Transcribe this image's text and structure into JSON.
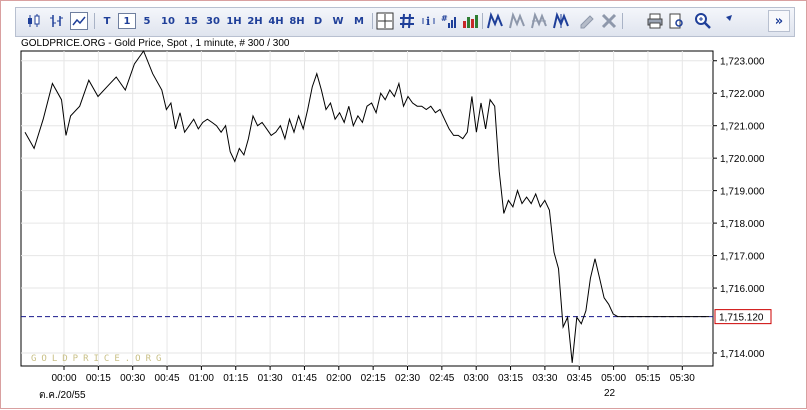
{
  "toolbar": {
    "icons": [
      "candlestick-icon",
      "bar-chart-icon",
      "line-chart-icon"
    ],
    "timeframes": [
      "T",
      "1",
      "5",
      "10",
      "15",
      "30",
      "1H",
      "2H",
      "4H",
      "8H",
      "D",
      "W",
      "M"
    ],
    "active_timeframe": "1",
    "tool_icons": [
      "crosshair-icon",
      "grid-icon",
      "info-icon",
      "price-labels-icon",
      "volume-icon",
      "trend-line-icon",
      "parallel-lines-icon",
      "channel-icon",
      "fibonacci-icon",
      "edit-icon",
      "delete-icon",
      "print-icon",
      "export-icon",
      "zoom-in-icon",
      "pointer-icon"
    ],
    "scroll_label": "»"
  },
  "caption": "GOLDPRICE.ORG - Gold Price, Spot , 1 minute, # 300 / 300",
  "watermark": "GOLDPRICE.ORG",
  "date_left": "ต.ค./20/55",
  "date_right": "22",
  "chart_data": {
    "type": "line",
    "title": "GOLDPRICE.ORG - Gold Price, Spot , 1 minute, # 300 / 300",
    "x_tick_labels": [
      "00:00",
      "00:15",
      "00:30",
      "00:45",
      "01:00",
      "01:15",
      "01:30",
      "01:45",
      "02:00",
      "02:15",
      "02:30",
      "02:45",
      "03:00",
      "03:15",
      "03:30",
      "03:45",
      "05:00",
      "05:15",
      "05:30"
    ],
    "y_tick_labels": [
      "1,723.000",
      "1,722.000",
      "1,721.000",
      "1,720.000",
      "1,719.000",
      "1,718.000",
      "1,717.000",
      "1,716.000",
      "1,714.000"
    ],
    "ylim": [
      1713.6,
      1723.3
    ],
    "grid": true,
    "line_color": "#000000",
    "current_price": 1715.12,
    "current_price_label": "1,715.120",
    "current_price_color": "#cc0000",
    "reference_line_color": "#1a1a8c",
    "series": [
      {
        "x": [
          0,
          4,
          8,
          12,
          16,
          18,
          20,
          24,
          28,
          32,
          36,
          40,
          44,
          48,
          52,
          56,
          60,
          62,
          64,
          66,
          68,
          70,
          72,
          74,
          76,
          78,
          80,
          82,
          84,
          86,
          88,
          90,
          92,
          94,
          96,
          98,
          100,
          102,
          104,
          106,
          108,
          110,
          112,
          114,
          116,
          118,
          120,
          122,
          124,
          126,
          128,
          130,
          132,
          134,
          136,
          138,
          140,
          142,
          144,
          146,
          148,
          150,
          152,
          154,
          156,
          158,
          160,
          162,
          164,
          166,
          168,
          170,
          172,
          174,
          176,
          178,
          180,
          182,
          184,
          186,
          188,
          190,
          192,
          194,
          196,
          198,
          200,
          202,
          204,
          206,
          208,
          210,
          212,
          214,
          216,
          218,
          220,
          222,
          224,
          226,
          228,
          230,
          232,
          234,
          236,
          238,
          240,
          242,
          244,
          246,
          248,
          250,
          252,
          254,
          256,
          258,
          260,
          262,
          264,
          266,
          268,
          270,
          272,
          274,
          276,
          278,
          280,
          282,
          284,
          286,
          288,
          290,
          292,
          294,
          296,
          298,
          300
        ],
        "values": [
          1720.8,
          1720.3,
          1721.2,
          1722.3,
          1721.8,
          1720.7,
          1721.3,
          1721.6,
          1722.4,
          1721.9,
          1722.2,
          1722.5,
          1722.1,
          1722.9,
          1723.3,
          1722.6,
          1722.1,
          1721.5,
          1721.7,
          1720.9,
          1721.4,
          1720.8,
          1721.0,
          1721.2,
          1720.9,
          1721.1,
          1721.2,
          1721.1,
          1721.0,
          1720.8,
          1721.0,
          1720.2,
          1719.9,
          1720.3,
          1720.1,
          1720.6,
          1721.3,
          1721.0,
          1721.1,
          1720.9,
          1720.7,
          1720.8,
          1721.0,
          1720.6,
          1721.2,
          1720.8,
          1721.3,
          1720.9,
          1721.5,
          1722.2,
          1722.6,
          1722.1,
          1721.5,
          1721.7,
          1721.2,
          1721.4,
          1721.1,
          1721.6,
          1721.0,
          1721.3,
          1721.1,
          1721.6,
          1721.7,
          1721.4,
          1722.0,
          1721.8,
          1722.1,
          1721.9,
          1722.3,
          1721.6,
          1721.9,
          1721.7,
          1721.6,
          1721.6,
          1721.5,
          1721.6,
          1721.4,
          1721.5,
          1721.2,
          1720.9,
          1720.7,
          1720.7,
          1720.6,
          1720.8,
          1721.9,
          1720.8,
          1721.7,
          1720.9,
          1721.8,
          1721.6,
          1719.6,
          1718.3,
          1718.7,
          1718.5,
          1719.0,
          1718.6,
          1718.8,
          1718.6,
          1718.9,
          1718.5,
          1718.7,
          1718.4,
          1717.1,
          1716.6,
          1714.8,
          1715.1,
          1713.7,
          1715.1,
          1714.9,
          1715.3,
          1716.3,
          1716.9,
          1716.3,
          1715.7,
          1715.5,
          1715.2,
          1715.12,
          1715.12,
          1715.12,
          1715.12,
          1715.12,
          1715.12,
          1715.12,
          1715.12,
          1715.12,
          1715.12,
          1715.12,
          1715.12,
          1715.12,
          1715.12,
          1715.12,
          1715.12,
          1715.12,
          1715.12,
          1715.12,
          1715.12,
          1715.12
        ]
      }
    ]
  }
}
